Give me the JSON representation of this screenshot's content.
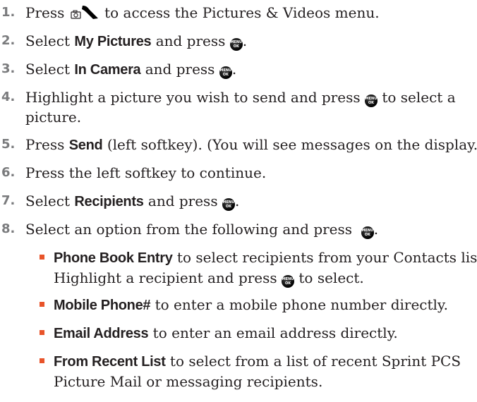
{
  "steps": [
    {
      "num": "1.",
      "pre": "Press",
      "post": "to access the Pictures & Videos menu."
    },
    {
      "num": "2.",
      "pre": "Select",
      "bold": "My Pictures",
      "post": "and press",
      "end": "."
    },
    {
      "num": "3.",
      "pre": "Select",
      "bold": "In Camera",
      "post": "and press",
      "end": "."
    },
    {
      "num": "4.",
      "pre": "Highlight a picture you wish to send and press",
      "post": "to select a",
      "line2": "picture."
    },
    {
      "num": "5.",
      "pre": "Press",
      "bold": "Send",
      "post": "(left softkey). (You will see messages on the display.)"
    },
    {
      "num": "6.",
      "pre": "Press the left softkey to continue."
    },
    {
      "num": "7.",
      "pre": "Select",
      "bold": "Recipients",
      "post": "and press",
      "end": "."
    },
    {
      "num": "8.",
      "pre": "Select an option from the following and press",
      "end": "."
    }
  ],
  "options": [
    {
      "bold": "Phone Book Entry",
      "text": "to select recipients from your Contacts list.",
      "line2_pre": "Highlight a recipient and press",
      "line2_post": "to select."
    },
    {
      "bold": "Mobile Phone#",
      "text": "to enter a mobile phone number directly."
    },
    {
      "bold": "Email Address",
      "text": "to enter an email address directly."
    },
    {
      "bold": "From Recent List",
      "text": "to select from a list of recent Sprint PCS",
      "line2": "Picture Mail or messaging recipients."
    }
  ],
  "menu_key": {
    "line1": "MENU",
    "line2": "OK"
  },
  "colors": {
    "bullet": "#e8542a",
    "step_number": "#7a7b7d",
    "text": "#231f20"
  },
  "icons": [
    "camera-icon",
    "end-key-icon",
    "menu-ok-key-icon"
  ]
}
